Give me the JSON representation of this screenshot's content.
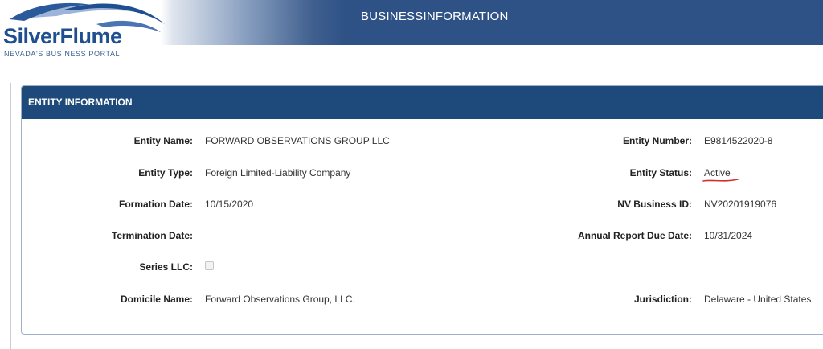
{
  "header": {
    "title": "BUSINESSINFORMATION"
  },
  "logo": {
    "wordmark": "SilverFlume",
    "tagline": "NEVADA'S BUSINESS PORTAL"
  },
  "panel": {
    "title": "ENTITY INFORMATION"
  },
  "fields": {
    "entity_name": {
      "label": "Entity Name:",
      "value": "FORWARD OBSERVATIONS GROUP LLC"
    },
    "entity_type": {
      "label": "Entity Type:",
      "value": "Foreign Limited-Liability Company"
    },
    "formation_date": {
      "label": "Formation Date:",
      "value": "10/15/2020"
    },
    "termination_date": {
      "label": "Termination Date:",
      "value": ""
    },
    "series_llc": {
      "label": "Series LLC:",
      "checked": false
    },
    "domicile_name": {
      "label": "Domicile Name:",
      "value": "Forward Observations Group, LLC."
    },
    "entity_number": {
      "label": "Entity Number:",
      "value": "E9814522020-8"
    },
    "entity_status": {
      "label": "Entity Status:",
      "value": "Active"
    },
    "nv_business_id": {
      "label": "NV Business ID:",
      "value": "NV20201919076"
    },
    "annual_report_due": {
      "label": "Annual Report Due Date:",
      "value": "10/31/2024"
    },
    "jurisdiction": {
      "label": "Jurisdiction:",
      "value": "Delaware - United States"
    }
  },
  "colors": {
    "header_bg": "#2e5186",
    "panel_header_bg": "#1d4a7a",
    "status_underline": "#d0302b"
  }
}
